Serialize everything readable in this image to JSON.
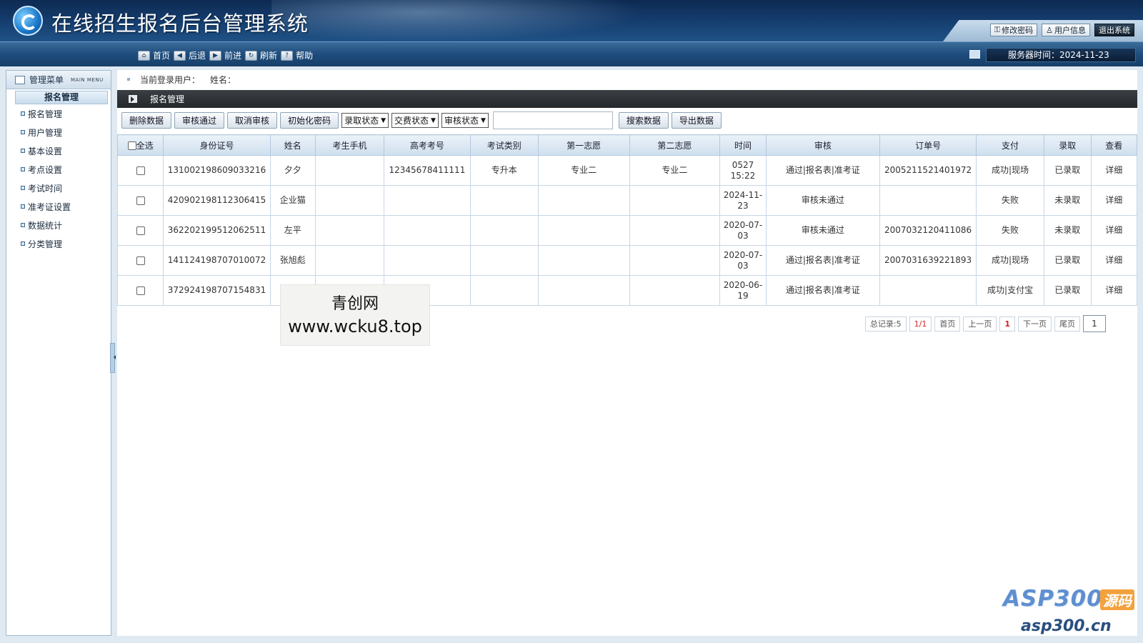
{
  "header": {
    "title": "在线招生报名后台管理系统",
    "buttons": [
      "修改密码",
      "用户信息",
      "退出系统"
    ]
  },
  "toolbar": {
    "items": [
      "首页",
      "后退",
      "前进",
      "刷新",
      "帮助"
    ],
    "server_time": "服务器时间：2024-11-23"
  },
  "sidebar": {
    "title": "管理菜单",
    "subtitle": "MAIN MENU",
    "group": "报名管理",
    "items": [
      "报名管理",
      "用户管理",
      "基本设置",
      "考点设置",
      "考试时间",
      "准考证设置",
      "数据统计",
      "分类管理"
    ]
  },
  "main": {
    "user_label": "当前登录用户：",
    "user_name_label": "姓名：",
    "section_title": "报名管理",
    "actions": {
      "delete": "删除数据",
      "approve": "审核通过",
      "cancel": "取消审核",
      "reset_pwd": "初始化密码",
      "admit_status": "录取状态",
      "pay_status": "交费状态",
      "review_status": "审核状态",
      "search_value": "",
      "search": "搜索数据",
      "export": "导出数据"
    },
    "table": {
      "headers": [
        "全选",
        "身份证号",
        "姓名",
        "考生手机",
        "高考考号",
        "考试类别",
        "第一志愿",
        "第二志愿",
        "时间",
        "审核",
        "订单号",
        "支付",
        "录取",
        "查看"
      ],
      "rows": [
        {
          "id": "131002198609033216",
          "name": "夕夕",
          "phone": "",
          "exam_no": "12345678411111",
          "category": "专升本",
          "first": "专业二",
          "second": "专业二",
          "time": "0527 15:22",
          "review": "通过|报名表|准考证",
          "order": "2005211521401972",
          "pay": "成功|现场",
          "admit": "已录取",
          "view": "详细"
        },
        {
          "id": "420902198112306415",
          "name": "企业猫",
          "phone": "",
          "exam_no": "",
          "category": "",
          "first": "",
          "second": "",
          "time": "2024-11-23",
          "review": "审核未通过",
          "order": "",
          "pay": "失败",
          "admit": "未录取",
          "view": "详细"
        },
        {
          "id": "362202199512062511",
          "name": "左平",
          "phone": "",
          "exam_no": "",
          "category": "",
          "first": "",
          "second": "",
          "time": "2020-07-03",
          "review": "审核未通过",
          "order": "2007032120411086",
          "pay": "失败",
          "admit": "未录取",
          "view": "详细"
        },
        {
          "id": "141124198707010072",
          "name": "张旭彪",
          "phone": "",
          "exam_no": "",
          "category": "",
          "first": "",
          "second": "",
          "time": "2020-07-03",
          "review": "通过|报名表|准考证",
          "order": "2007031639221893",
          "pay": "成功|现场",
          "admit": "已录取",
          "view": "详细"
        },
        {
          "id": "372924198707154831",
          "name": "",
          "phone": "",
          "exam_no": "",
          "category": "",
          "first": "",
          "second": "",
          "time": "2020-06-19",
          "review": "通过|报名表|准考证",
          "order": "",
          "pay": "成功|支付宝",
          "admit": "已录取",
          "view": "详细"
        }
      ]
    },
    "pager": {
      "total": "总记录:5",
      "pages": "1/1",
      "first": "首页",
      "prev": "上一页",
      "current": "1",
      "next": "下一页",
      "last": "尾页",
      "input_value": "1"
    }
  },
  "watermarks": {
    "center_line1": "青创网",
    "center_line2": "www.wcku8.top",
    "corner_brand": "ASP300",
    "corner_tag": "源码",
    "corner_url": "asp300.cn"
  },
  "colors": {
    "success": "#2c8a1e",
    "fail": "#c62828",
    "link": "#1f6fb5",
    "header_bg": "#143b6b"
  }
}
